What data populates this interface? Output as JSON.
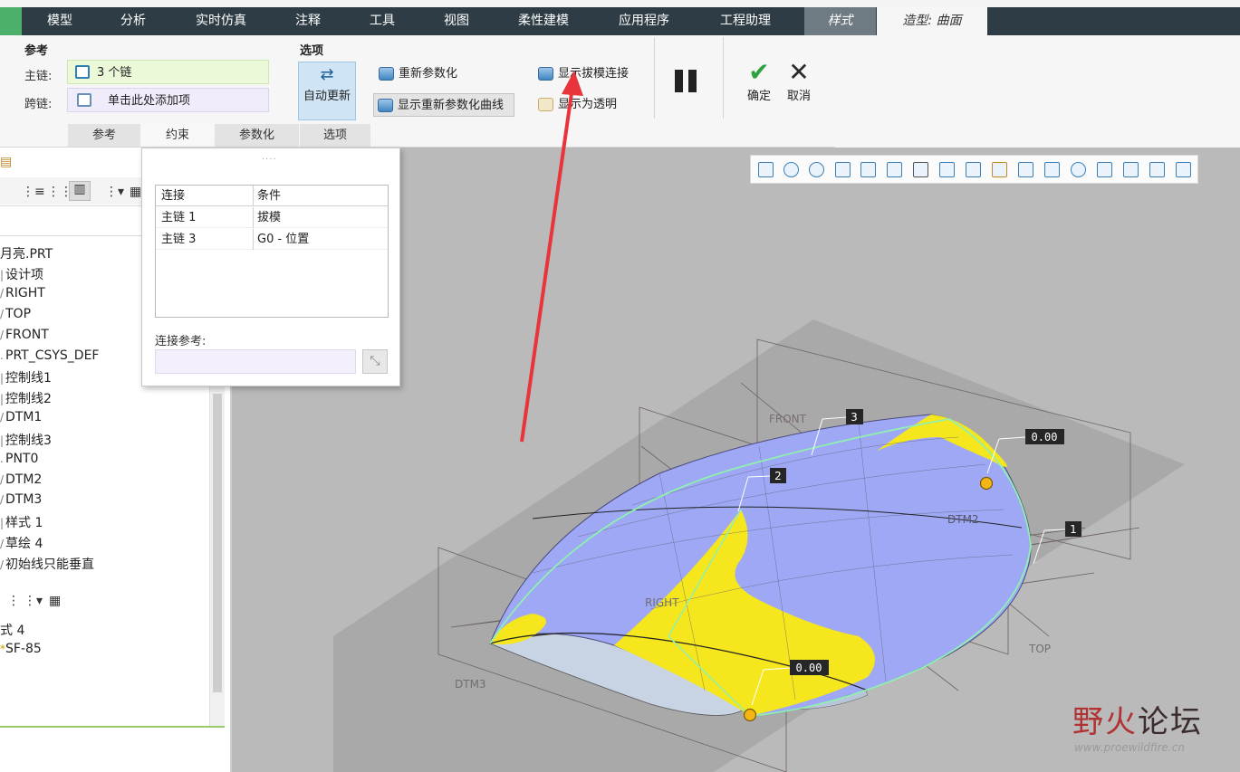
{
  "menubar": {
    "tabs": [
      "模型",
      "分析",
      "实时仿真",
      "注释",
      "工具",
      "视图",
      "柔性建模",
      "应用程序",
      "工程助理"
    ],
    "style_tab": "样式",
    "active_tab": "造型: 曲面"
  },
  "ribbon": {
    "reference": {
      "title": "参考",
      "main_chain_label": "主链:",
      "main_chain_value": "3 个链",
      "cross_chain_label": "跨链:",
      "cross_chain_value": "单击此处添加项"
    },
    "options": {
      "title": "选项",
      "auto_update": "自动更新",
      "reparametrize": "重新参数化",
      "show_reparam_curves": "显示重新参数化曲线",
      "show_draft_connection": "显示拔模连接",
      "show_transparent": "显示为透明"
    },
    "ok": "确定",
    "cancel": "取消",
    "subtabs": [
      "参考",
      "约束",
      "参数化",
      "选项"
    ]
  },
  "tree": {
    "items": [
      "月亮.PRT",
      "设计项",
      "RIGHT",
      "TOP",
      "FRONT",
      "PRT_CSYS_DEF",
      "控制线1",
      "控制线2",
      "DTM1",
      "控制线3",
      "PNT0",
      "DTM2",
      "DTM3",
      "样式 1",
      "草绘 4",
      "初始线只能垂直"
    ],
    "lower_items": [
      "式 4",
      "SF-85"
    ]
  },
  "constraints": {
    "col_connection": "连接",
    "col_condition": "条件",
    "rows": [
      {
        "connection": "主链 1",
        "condition": "拔模"
      },
      {
        "connection": "主链 3",
        "condition": "G0 - 位置"
      }
    ],
    "connection_ref_label": "连接参考:"
  },
  "viewport": {
    "labels": {
      "front": "FRONT",
      "right": "RIGHT",
      "top": "TOP",
      "dtm2": "DTM2",
      "dtm3": "DTM3",
      "chain1": "1",
      "chain2": "2",
      "chain3": "3",
      "value_top": "0.00",
      "value_bottom": "0.00"
    }
  },
  "watermark": {
    "title_left": "野火",
    "title_right": "论坛",
    "url": "www.proewildfire.cn"
  },
  "colors": {
    "menubar": "#2e3d45",
    "surface_blue": "#9ea8f5",
    "surface_yellow": "#f5e61d",
    "accent_red": "#e8343a"
  }
}
